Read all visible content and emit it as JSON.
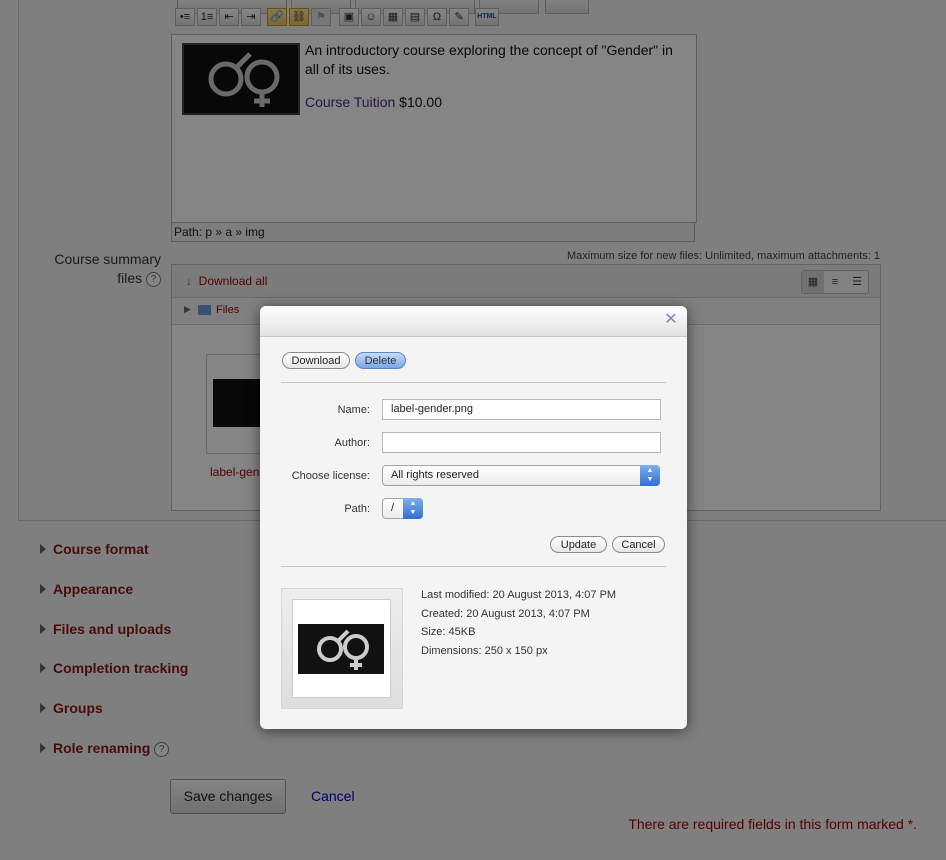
{
  "editor": {
    "toolbar_row1": [
      "•≡",
      "1≡",
      "⇤",
      "⇥",
      "🔗",
      "⛓",
      "⚑",
      "▣",
      "☺",
      "▦",
      "▤",
      "Ω",
      "✎",
      "HTML"
    ],
    "paragraph1": "An introductory course exploring the concept of \"Gender\" in all of its uses.",
    "tuition_link": "Course Tuition",
    "tuition_price": " $10.00",
    "path": "Path: p » a » img"
  },
  "summary_files": {
    "label": "Course summary files",
    "label_line1": "Course summary",
    "label_line2": "files",
    "help": "?",
    "max_size_note": "Maximum size for new files: Unlimited, maximum attachments: 1",
    "download_all": "Download all",
    "folder": "Files",
    "thumb_label": "label-gender.png",
    "thumb_label_visible": "label-gende"
  },
  "sections": [
    {
      "label": "Course format"
    },
    {
      "label": "Appearance"
    },
    {
      "label": "Files and uploads"
    },
    {
      "label": "Completion tracking"
    },
    {
      "label": "Groups"
    },
    {
      "label": "Role renaming"
    }
  ],
  "footer": {
    "save": "Save changes",
    "cancel": "Cancel",
    "required_note": "There are required fields in this form marked ",
    "required_mark": "*."
  },
  "dialog": {
    "close": "✕",
    "download": "Download",
    "delete": "Delete",
    "name_label": "Name:",
    "name_value": "label-gender.png",
    "author_label": "Author:",
    "author_value": "",
    "license_label": "Choose license:",
    "license_value": "All rights reserved",
    "path_label": "Path:",
    "path_value": "/",
    "update": "Update",
    "cancel": "Cancel",
    "last_modified": "Last modified: 20 August 2013, 4:07 PM",
    "created": "Created: 20 August 2013, 4:07 PM",
    "size": "Size: 45KB",
    "dimensions": "Dimensions: 250 x 150 px"
  },
  "colors": {
    "section_title": "#8b1a10",
    "link_blue": "#0000cc",
    "delete_button": "#7aa6e6",
    "select_arrows": "#2f6fd0"
  }
}
